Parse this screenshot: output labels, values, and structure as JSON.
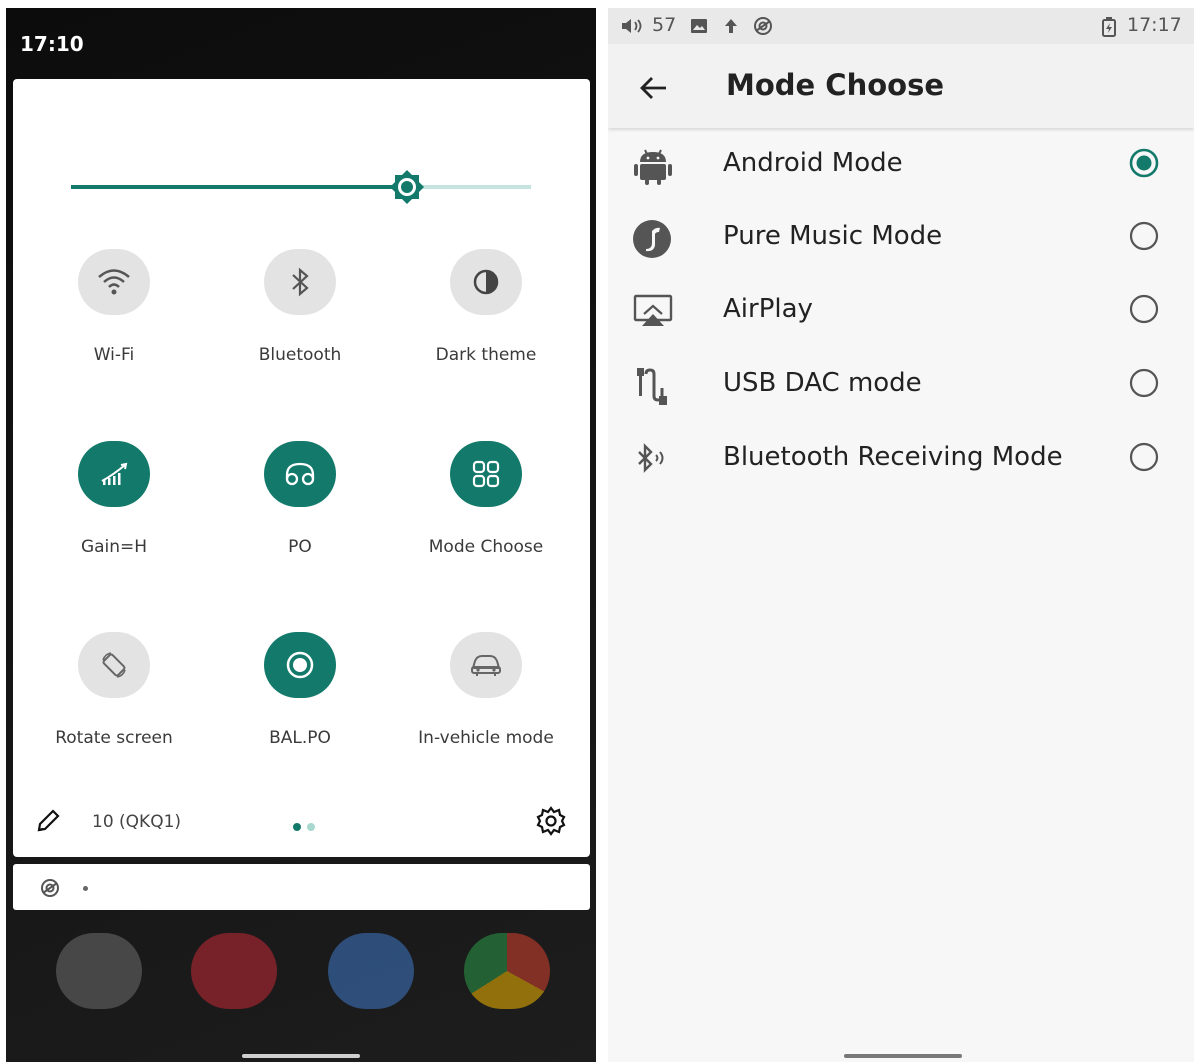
{
  "left_phone": {
    "status_time": "17:10",
    "brightness_level": 0.73,
    "tiles": [
      {
        "label": "Wi-Fi",
        "icon": "wifi-icon",
        "active": false
      },
      {
        "label": "Bluetooth",
        "icon": "bluetooth-icon",
        "active": false
      },
      {
        "label": "Dark theme",
        "icon": "dark-theme-icon",
        "active": false
      },
      {
        "label": "Gain=H",
        "icon": "gain-icon",
        "active": true
      },
      {
        "label": "PO",
        "icon": "headphones-icon",
        "active": true
      },
      {
        "label": "Mode Choose",
        "icon": "grid-icon",
        "active": true
      },
      {
        "label": "Rotate screen",
        "icon": "rotate-icon",
        "active": false
      },
      {
        "label": "BAL.PO",
        "icon": "balanced-output-icon",
        "active": true
      },
      {
        "label": "In-vehicle mode",
        "icon": "car-icon",
        "active": false
      }
    ],
    "build_number": "10 (QKQ1)",
    "accent_color": "#137a6b"
  },
  "right_phone": {
    "status": {
      "volume": "57",
      "time": "17:17"
    },
    "title": "Mode Choose",
    "modes": [
      {
        "label": "Android Mode",
        "icon": "android-icon",
        "selected": true
      },
      {
        "label": "Pure Music Mode",
        "icon": "music-note-icon",
        "selected": false
      },
      {
        "label": "AirPlay",
        "icon": "airplay-icon",
        "selected": false
      },
      {
        "label": "USB DAC mode",
        "icon": "usb-cable-icon",
        "selected": false
      },
      {
        "label": "Bluetooth Receiving Mode",
        "icon": "bluetooth-receive-icon",
        "selected": false
      }
    ]
  }
}
